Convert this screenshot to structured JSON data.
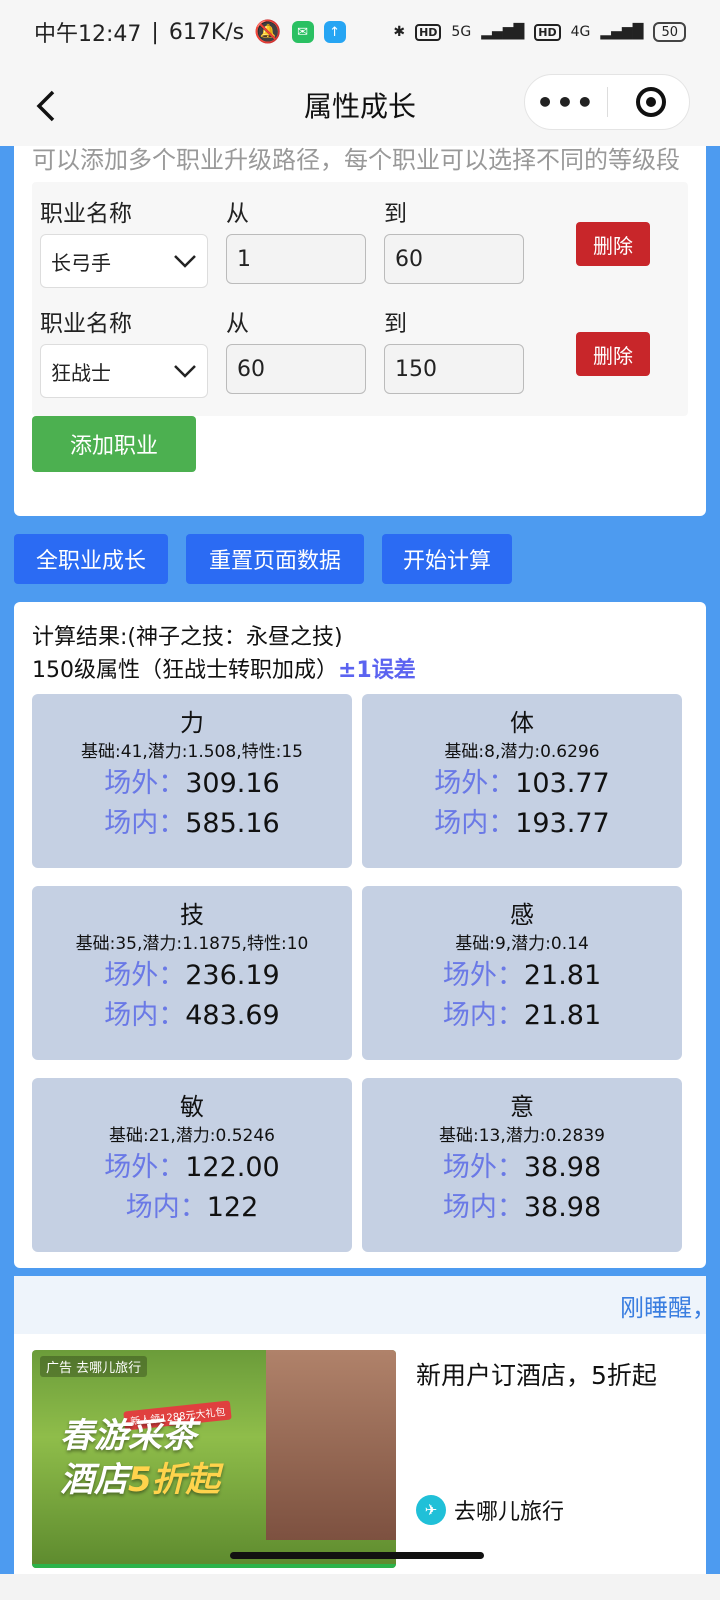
{
  "status_bar": {
    "time": "中午12:47",
    "speed": "617K/s",
    "network_5g": "5G",
    "network_4g": "4G",
    "hd": "HD",
    "battery": "50"
  },
  "nav": {
    "title": "属性成长",
    "more": "•••"
  },
  "path_card": {
    "hint": "可以添加多个职业升级路径，每个职业可以选择不同的等级段",
    "rows": [
      {
        "job_label": "职业名称",
        "job": "长弓手",
        "from_label": "从",
        "from": "1",
        "to_label": "到",
        "to": "60",
        "delete": "删除"
      },
      {
        "job_label": "职业名称",
        "job": "狂战士",
        "from_label": "从",
        "from": "60",
        "to_label": "到",
        "to": "150",
        "delete": "删除"
      }
    ],
    "add_button": "添加职业"
  },
  "actions": {
    "all_growth": "全职业成长",
    "reset": "重置页面数据",
    "calculate": "开始计算"
  },
  "results": {
    "title": "计算结果:(神子之技：永昼之技)",
    "subtitle": "150级属性（狂战士转职加成）",
    "error_note": "±1误差",
    "outside_label": "场外：",
    "inside_label": "场内：",
    "stats": [
      {
        "name": "力",
        "base": "基础:41,潜力:1.508,特性:15",
        "outside": "309.16",
        "inside": "585.16"
      },
      {
        "name": "体",
        "base": "基础:8,潜力:0.6296",
        "outside": "103.77",
        "inside": "193.77"
      },
      {
        "name": "技",
        "base": "基础:35,潜力:1.1875,特性:10",
        "outside": "236.19",
        "inside": "483.69"
      },
      {
        "name": "感",
        "base": "基础:9,潜力:0.14",
        "outside": "21.81",
        "inside": "21.81"
      },
      {
        "name": "敏",
        "base": "基础:21,潜力:0.5246",
        "outside": "122.00",
        "inside": "122"
      },
      {
        "name": "意",
        "base": "基础:13,潜力:0.2839",
        "outside": "38.98",
        "inside": "38.98"
      }
    ]
  },
  "ad": {
    "marquee": "刚睡醒，",
    "tag": "广告",
    "brand_tag": "去哪儿旅行",
    "promo_tag": "新人领1288元大礼包",
    "headline_1": "春游采茶",
    "headline_2a": "酒店",
    "headline_2b": "5折起",
    "text": "新用户订酒店，5折起",
    "vendor": "去哪儿旅行"
  }
}
